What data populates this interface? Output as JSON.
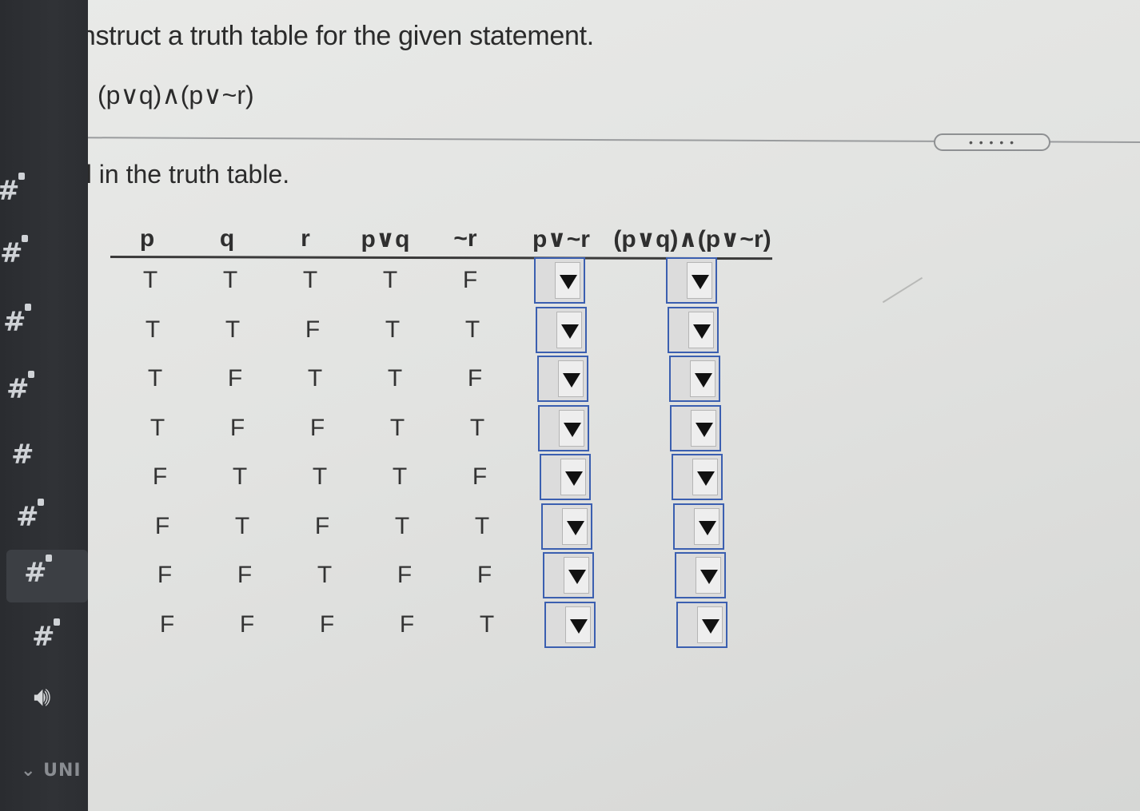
{
  "sidebar": {
    "channel_icons": [
      "hash-lock-icon",
      "hash-lock-icon",
      "hash-lock-icon",
      "hash-lock-icon",
      "hash-icon",
      "hash-lock-icon",
      "hash-lock-icon",
      "hash-lock-icon"
    ],
    "voice_icon": "speaker-icon",
    "category_label": "UNI"
  },
  "question": {
    "title": "Construct a truth table for the given statement.",
    "statement": "(p∨q)∧(p∨~r)",
    "more_button": "• • • • •",
    "instruction": "Fill in the truth table."
  },
  "table": {
    "headers": [
      "p",
      "q",
      "r",
      "p∨q",
      "~r",
      "p∨~r",
      "(p∨q)∧(p∨~r)"
    ],
    "rows": [
      [
        "T",
        "T",
        "T",
        "T",
        "F"
      ],
      [
        "T",
        "T",
        "F",
        "T",
        "T"
      ],
      [
        "T",
        "F",
        "T",
        "T",
        "F"
      ],
      [
        "T",
        "F",
        "F",
        "T",
        "T"
      ],
      [
        "F",
        "T",
        "T",
        "T",
        "F"
      ],
      [
        "F",
        "T",
        "F",
        "T",
        "T"
      ],
      [
        "F",
        "F",
        "T",
        "F",
        "F"
      ],
      [
        "F",
        "F",
        "F",
        "F",
        "T"
      ]
    ],
    "dropdown_value": "",
    "dropdown_icon": "triangle-down-icon"
  }
}
